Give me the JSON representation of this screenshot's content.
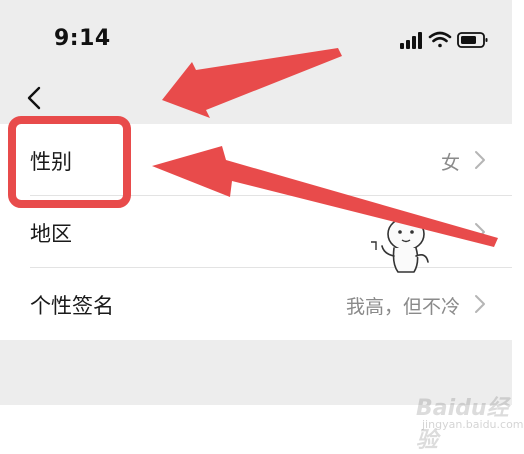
{
  "status_bar": {
    "time": "9:14",
    "icons": [
      "signal-icon",
      "wifi-icon",
      "battery-icon"
    ]
  },
  "nav": {
    "back_icon": "chevron-left-icon"
  },
  "list": {
    "items": [
      {
        "label": "性别",
        "value": "女"
      },
      {
        "label": "地区",
        "value": ""
      },
      {
        "label": "个性签名",
        "value": "我高，但不冷"
      }
    ]
  },
  "annotations": {
    "highlight_color": "#e84b4b",
    "arrow_color": "#e84b4b"
  },
  "watermark": {
    "brand": "Baidu经验",
    "sub": "jingyan.baidu.com"
  },
  "colors": {
    "page_background": "#ededed",
    "list_background": "#ffffff",
    "value_text": "#8a8a8a"
  }
}
